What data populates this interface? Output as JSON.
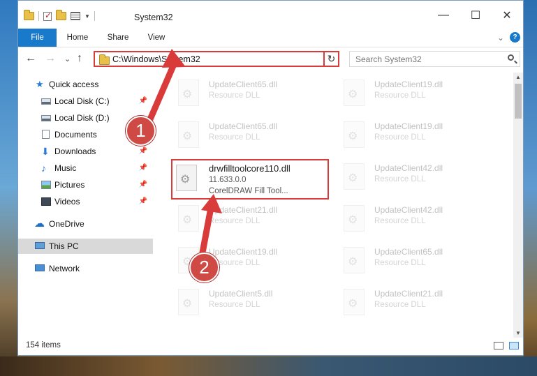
{
  "window": {
    "title": "System32",
    "minimize_glyph": "—",
    "maximize_glyph": "☐",
    "close_glyph": "✕"
  },
  "ribbon": {
    "tabs": [
      "File",
      "Home",
      "Share",
      "View"
    ],
    "expand_glyph": "⌄",
    "help_glyph": "?"
  },
  "nav": {
    "back_glyph": "←",
    "forward_glyph": "→",
    "recent_glyph": "⌄",
    "up_glyph": "↑",
    "address": "C:\\Windows\\System32",
    "refresh_glyph": "↻",
    "dropdown_glyph": "⌄",
    "search_placeholder": "Search System32"
  },
  "sidebar": {
    "items": [
      {
        "label": "Quick access",
        "icon": "star-icon",
        "pinned": false
      },
      {
        "label": "Local Disk (C:)",
        "icon": "drive-icon",
        "pinned": true
      },
      {
        "label": "Local Disk (D:)",
        "icon": "drive-icon",
        "pinned": false
      },
      {
        "label": "Documents",
        "icon": "document-icon",
        "pinned": true
      },
      {
        "label": "Downloads",
        "icon": "download-icon",
        "pinned": true
      },
      {
        "label": "Music",
        "icon": "music-icon",
        "pinned": true
      },
      {
        "label": "Pictures",
        "icon": "pictures-icon",
        "pinned": true
      },
      {
        "label": "Videos",
        "icon": "videos-icon",
        "pinned": true
      },
      {
        "label": "OneDrive",
        "icon": "cloud-icon",
        "pinned": false
      },
      {
        "label": "This PC",
        "icon": "computer-icon",
        "pinned": false
      },
      {
        "label": "Network",
        "icon": "network-icon",
        "pinned": false
      }
    ],
    "pin_glyph": "📌"
  },
  "files": {
    "left": [
      {
        "name": "UpdateClient65.dll",
        "desc": "Resource DLL"
      },
      {
        "name": "UpdateClient65.dll",
        "desc": "Resource DLL"
      },
      {
        "name": "UpdateClient21.dll",
        "desc": "Resource DLL"
      },
      {
        "name": "UpdateClient19.dll",
        "desc": "Resource DLL"
      },
      {
        "name": "UpdateClient5.dll",
        "desc": "Resource DLL"
      }
    ],
    "highlighted": {
      "name": "drwfilltoolcore110.dll",
      "version": "11.633.0.0",
      "desc": "CorelDRAW Fill Tool..."
    },
    "right": [
      {
        "name": "UpdateClient19.dll",
        "desc": "Resource DLL"
      },
      {
        "name": "UpdateClient19.dll",
        "desc": "Resource DLL"
      },
      {
        "name": "UpdateClient42.dll",
        "desc": "Resource DLL"
      },
      {
        "name": "UpdateClient42.dll",
        "desc": "Resource DLL"
      },
      {
        "name": "UpdateClient65.dll",
        "desc": "Resource DLL"
      },
      {
        "name": "UpdateClient21.dll",
        "desc": "Resource DLL"
      }
    ]
  },
  "status": {
    "item_count": "154 items"
  },
  "annotations": {
    "step1": "1",
    "step2": "2",
    "color": "#d93a3a"
  }
}
